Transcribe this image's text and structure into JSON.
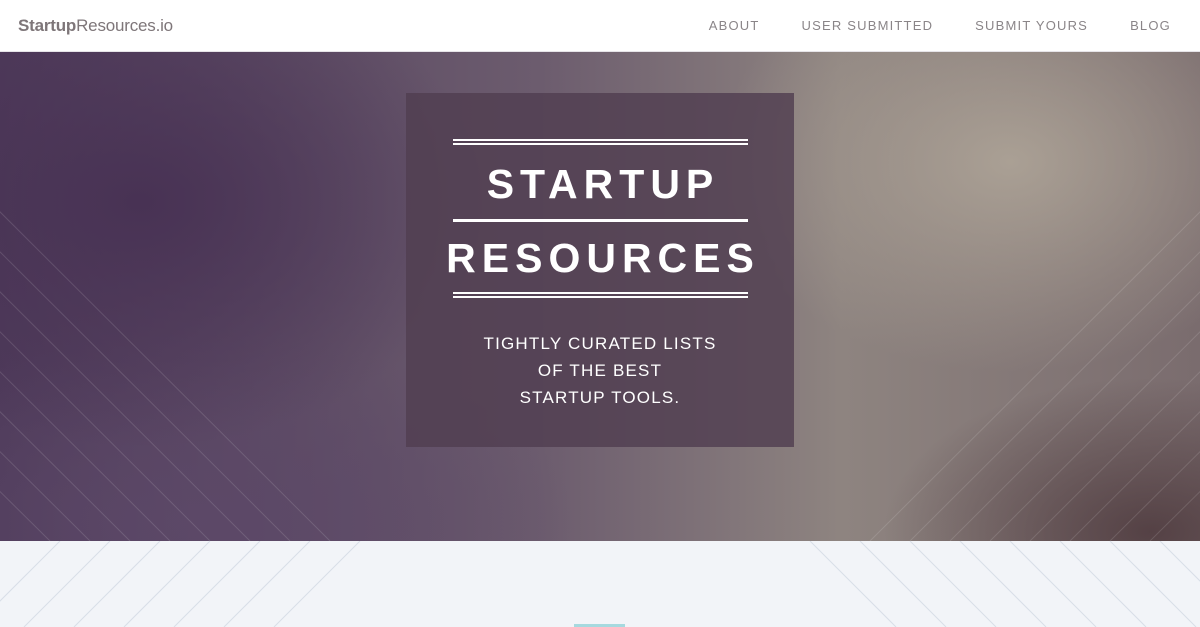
{
  "header": {
    "logo_bold": "Startup",
    "logo_rest": "Resources.io",
    "nav": [
      {
        "label": "ABOUT"
      },
      {
        "label": "USER SUBMITTED"
      },
      {
        "label": "SUBMIT YOURS"
      },
      {
        "label": "BLOG"
      }
    ]
  },
  "hero": {
    "title_line1": "STARTUP",
    "title_line2": "RESOURCES",
    "tagline": [
      "TIGHTLY CURATED LISTS",
      "OF THE BEST",
      "STARTUP TOOLS."
    ]
  },
  "colors": {
    "card": "#503e50",
    "accent": "#a6d9df",
    "nav_text": "#8a8588"
  }
}
